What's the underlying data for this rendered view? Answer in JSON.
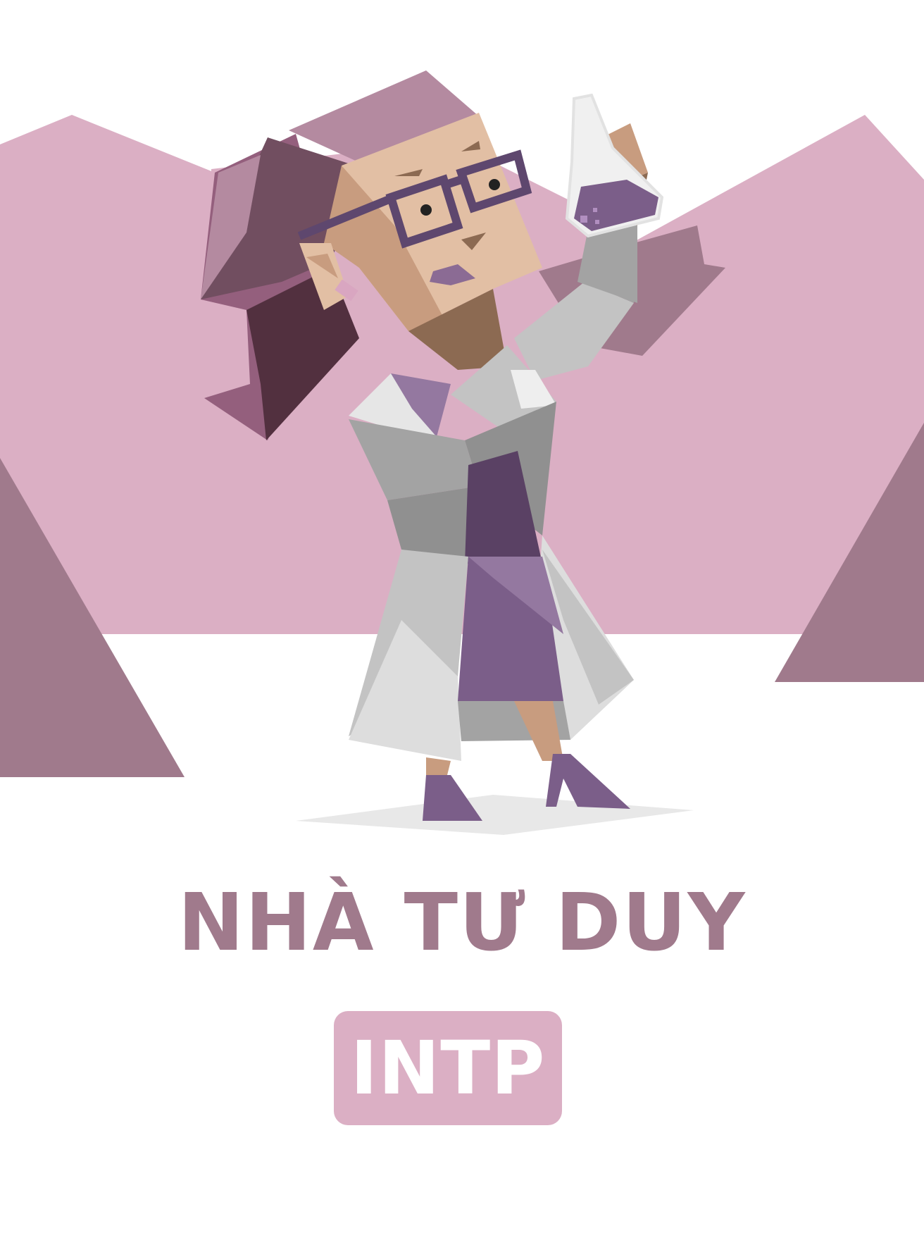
{
  "personality": {
    "name": "NHÀ TƯ DUY",
    "code": "INTP"
  },
  "colors": {
    "title": "#a07a8c",
    "badge_bg": "#dbafc4",
    "badge_text": "#ffffff",
    "mountain_light": "#dbafc4",
    "mountain_dark": "#a07a8c",
    "background": "#ffffff"
  },
  "illustration": {
    "subject": "scientist-woman-holding-flask",
    "icon": "erlenmeyer-flask-icon"
  }
}
